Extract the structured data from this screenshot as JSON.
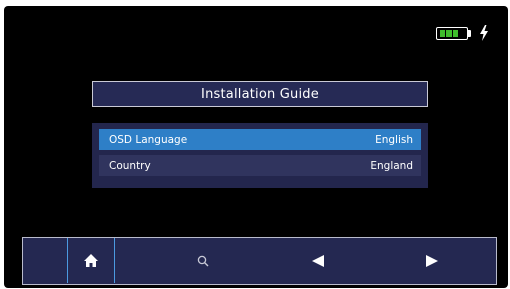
{
  "status": {
    "battery_icon": "battery-icon",
    "battery_level": 0.75,
    "charging_icon": "lightning-bolt-icon"
  },
  "dialog": {
    "title": "Installation Guide",
    "items": [
      {
        "label": "OSD Language",
        "value": "English",
        "selected": true
      },
      {
        "label": "Country",
        "value": "England",
        "selected": false
      }
    ]
  },
  "toolbar": {
    "buttons": [
      {
        "icon": "home-icon",
        "active": true
      },
      {
        "icon": "search-icon",
        "active": false
      },
      {
        "icon": "arrow-left-icon",
        "active": false
      },
      {
        "icon": "arrow-right-icon",
        "active": false
      }
    ]
  },
  "colors": {
    "accent": "#2e7fc7",
    "panel": "#23264d",
    "battery": "#3fbd2c"
  }
}
